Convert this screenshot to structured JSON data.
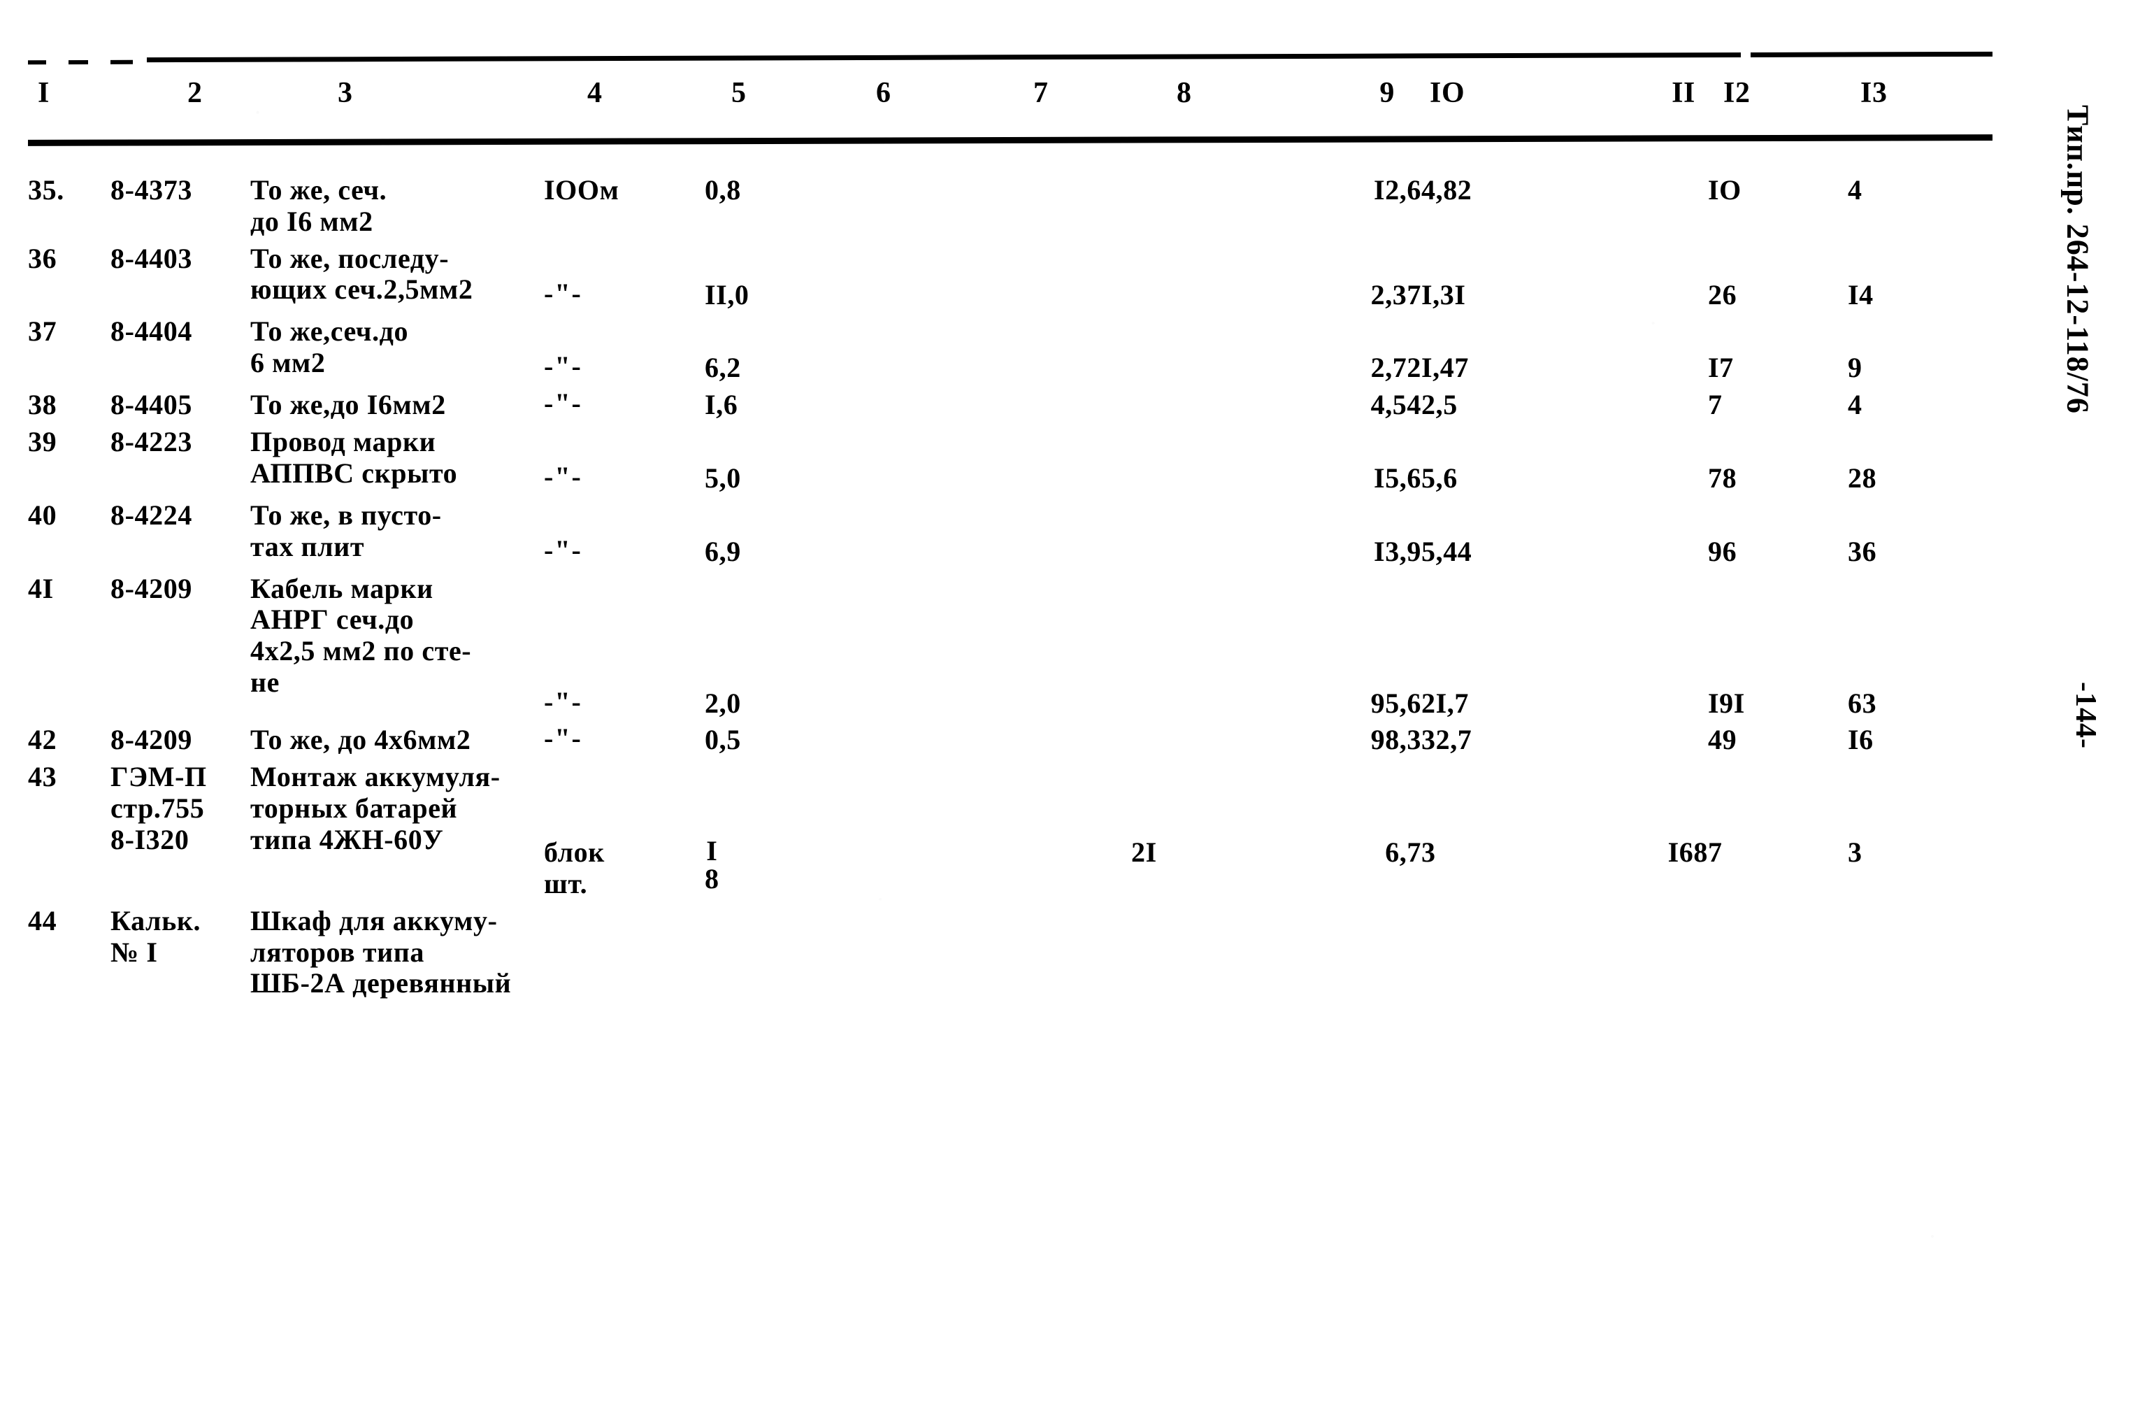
{
  "document": {
    "side_imprint": "Тип.пр. 264-12-118/76",
    "page_number": "-144-"
  },
  "table": {
    "column_headers": [
      "I",
      "2",
      "3",
      "4",
      "5",
      "6",
      "7",
      "8",
      "9",
      "IO",
      "II",
      "I2",
      "I3"
    ],
    "rows": [
      {
        "num": "35.",
        "code": "8-4373",
        "description": "То же, сеч.\nдо I6 мм2",
        "unit": "IOOм",
        "v5": "0,8",
        "v6": "",
        "v7": "",
        "v8": "",
        "v9": "I2,6",
        "v10": "4,82",
        "v11": "",
        "v12": "IO",
        "v13": "4",
        "value_offset": 0
      },
      {
        "num": "36",
        "code": "8-4403",
        "description": "То же, последу-\nющих сеч.2,5мм2",
        "unit": "-\"-",
        "v5": "II,0",
        "v6": "",
        "v7": "",
        "v8": "",
        "v9": "2,37",
        "v10": "I,3I",
        "v11": "",
        "v12": "26",
        "v13": "I4",
        "value_offset": 1
      },
      {
        "num": "37",
        "code": "8-4404",
        "description": "То же,сеч.до\n6 мм2",
        "unit": "-\"-",
        "v5": "6,2",
        "v6": "",
        "v7": "",
        "v8": "",
        "v9": "2,72",
        "v10": "I,47",
        "v11": "",
        "v12": "I7",
        "v13": "9",
        "value_offset": 1
      },
      {
        "num": "38",
        "code": "8-4405",
        "description": "То же,до I6мм2",
        "unit": "-\"-",
        "v5": "I,6",
        "v6": "",
        "v7": "",
        "v8": "",
        "v9": "4,54",
        "v10": "2,5",
        "v11": "",
        "v12": "7",
        "v13": "4",
        "value_offset": 0
      },
      {
        "num": "39",
        "code": "8-4223",
        "description": "Провод марки\nАППВС скрыто",
        "unit": "-\"-",
        "v5": "5,0",
        "v6": "",
        "v7": "",
        "v8": "",
        "v9": "I5,6",
        "v10": "5,6",
        "v11": "",
        "v12": "78",
        "v13": "28",
        "value_offset": 1
      },
      {
        "num": "40",
        "code": "8-4224",
        "description": "То же, в пусто-\nтах плит",
        "unit": "-\"-",
        "v5": "6,9",
        "v6": "",
        "v7": "",
        "v8": "",
        "v9": "I3,9",
        "v10": "5,44",
        "v11": "",
        "v12": "96",
        "v13": "36",
        "value_offset": 1
      },
      {
        "num": "4I",
        "code": "8-4209",
        "description": "Кабель марки\nАНРГ сеч.до\n4х2,5 мм2 по сте-\nне",
        "unit": "-\"-",
        "v5": "2,0",
        "v6": "",
        "v7": "",
        "v8": "",
        "v9": "95,6",
        "v10": "2I,7",
        "v11": "",
        "v12": "I9I",
        "v13": "63",
        "value_offset": 3
      },
      {
        "num": "42",
        "code": "8-4209",
        "description": "То же, до 4х6мм2",
        "unit": "-\"-",
        "v5": "0,5",
        "v6": "",
        "v7": "",
        "v8": "",
        "v9": "98,3",
        "v10": "32,7",
        "v11": "",
        "v12": "49",
        "v13": "I6",
        "value_offset": 0
      },
      {
        "num": "43",
        "code": "ГЭМ-П\nстр.755\n8-I320",
        "description": "Монтаж аккумуля-\nторных батарей\nтипа 4ЖН-60У",
        "unit": "блок\nшт.",
        "v5_stacked": [
          "I",
          "8"
        ],
        "v5": "",
        "v6": "",
        "v7": "",
        "v8": "2I",
        "v9": "6,7",
        "v10": "3",
        "v11": "I68",
        "v12": "7",
        "v13": "3",
        "value_offset": 2
      },
      {
        "num": "44",
        "code": "Кальк.\n№ I",
        "description": "Шкаф для аккуму-\nляторов типа\nШБ-2А деревянный",
        "unit": "",
        "v5": "",
        "v6": "",
        "v7": "",
        "v8": "",
        "v9": "",
        "v10": "",
        "v11": "",
        "v12": "",
        "v13": "",
        "value_offset": 0
      }
    ]
  }
}
